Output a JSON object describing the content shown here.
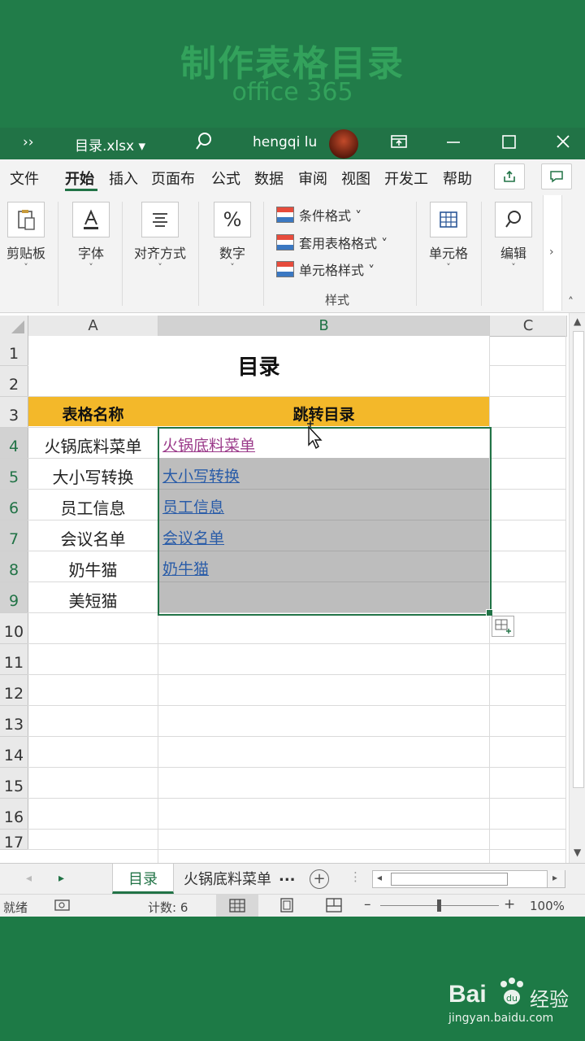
{
  "banner": {
    "title": "制作表格目录",
    "subtitle": "office 365"
  },
  "titlebar": {
    "more": "››",
    "filename": "目录.xlsx ▾",
    "user": "hengqi lu"
  },
  "ribbon_tabs": [
    "文件",
    "开始",
    "插入",
    "页面布",
    "公式",
    "数据",
    "审阅",
    "视图",
    "开发工",
    "帮助"
  ],
  "ribbon": {
    "clipboard": "剪贴板",
    "font": "字体",
    "align": "对齐方式",
    "number": "数字",
    "cond_format": "条件格式 ˅",
    "table_format": "套用表格格式 ˅",
    "cell_style": "单元格样式 ˅",
    "styles_group": "样式",
    "cells": "单元格",
    "editing": "编辑"
  },
  "columns": [
    "A",
    "B",
    "C"
  ],
  "rows": [
    "1",
    "2",
    "3",
    "4",
    "5",
    "6",
    "7",
    "8",
    "9",
    "10",
    "11",
    "12",
    "13",
    "14",
    "15",
    "16",
    "17"
  ],
  "sheet": {
    "title": "目录",
    "header_a": "表格名称",
    "header_b": "跳转目录",
    "names": [
      "火锅底料菜单",
      "大小写转换",
      "员工信息",
      "会议名单",
      "奶牛猫",
      "美短猫"
    ],
    "links": [
      "火锅底料菜单",
      "大小写转换",
      "员工信息",
      "会议名单",
      "奶牛猫"
    ]
  },
  "sheet_tabs": {
    "active": "目录",
    "other": "火锅底料菜单",
    "ellipsis": "..."
  },
  "status": {
    "ready": "就绪",
    "count": "计数: 6",
    "zoom": "100%"
  },
  "watermark": {
    "brand": "Bai",
    "brand2": "经验",
    "url": "jingyan.baidu.com"
  },
  "colors": {
    "excel_green": "#217346",
    "header_fill": "#f3b82a",
    "selection": "#bdbdbd",
    "link": "#2a5ca8",
    "visited_link": "#9b3b8a"
  }
}
